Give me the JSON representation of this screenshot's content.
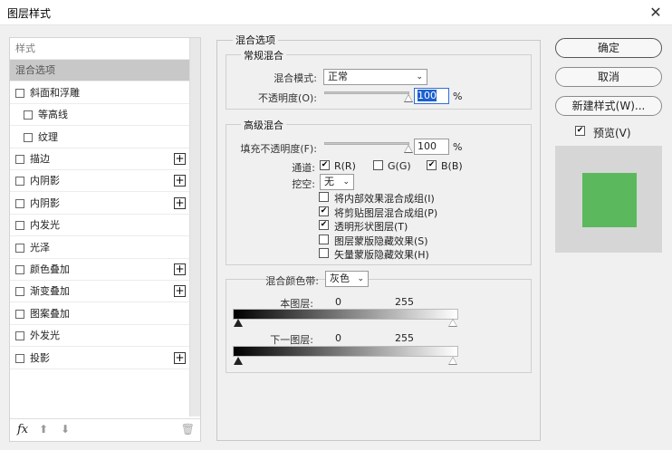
{
  "window": {
    "title": "图层样式",
    "close_glyph": "✕"
  },
  "left_panel": {
    "items": [
      {
        "label": "样式",
        "kind": "section"
      },
      {
        "label": "混合选项",
        "kind": "selected"
      },
      {
        "label": "斜面和浮雕",
        "kind": "check",
        "checked": false,
        "plus": false
      },
      {
        "label": "等高线",
        "kind": "check-indent",
        "checked": false,
        "plus": false
      },
      {
        "label": "纹理",
        "kind": "check-indent",
        "checked": false,
        "plus": false
      },
      {
        "label": "描边",
        "kind": "check",
        "checked": false,
        "plus": true
      },
      {
        "label": "内阴影",
        "kind": "check",
        "checked": false,
        "plus": true
      },
      {
        "label": "内阴影",
        "kind": "check",
        "checked": false,
        "plus": true
      },
      {
        "label": "内发光",
        "kind": "check",
        "checked": false,
        "plus": false
      },
      {
        "label": "光泽",
        "kind": "check",
        "checked": false,
        "plus": false
      },
      {
        "label": "颜色叠加",
        "kind": "check",
        "checked": false,
        "plus": true
      },
      {
        "label": "渐变叠加",
        "kind": "check",
        "checked": false,
        "plus": true
      },
      {
        "label": "图案叠加",
        "kind": "check",
        "checked": false,
        "plus": false
      },
      {
        "label": "外发光",
        "kind": "check",
        "checked": false,
        "plus": false
      },
      {
        "label": "投影",
        "kind": "check",
        "checked": false,
        "plus": true
      }
    ],
    "plus_glyph": "+",
    "footer": {
      "fx": "fx",
      "up": "⬆",
      "down": "⬇",
      "trash": "🗑"
    }
  },
  "blend_options": {
    "legend": "混合选项",
    "general": {
      "legend": "常规混合",
      "mode_label": "混合模式:",
      "mode_value": "正常",
      "opacity_label": "不透明度(O):",
      "opacity_value": "100",
      "opacity_fraction": 1.0,
      "pct": "%"
    },
    "advanced": {
      "legend": "高级混合",
      "fill_label": "填充不透明度(F):",
      "fill_value": "100",
      "fill_fraction": 1.0,
      "pct": "%",
      "channels_label": "通道:",
      "channel_r": "R(R)",
      "channel_g": "G(G)",
      "channel_b": "B(B)",
      "knockout_label": "挖空:",
      "knockout_value": "无",
      "options": [
        {
          "label": "将内部效果混合成组(I)",
          "checked": false
        },
        {
          "label": "将剪贴图层混合成组(P)",
          "checked": true
        },
        {
          "label": "透明形状图层(T)",
          "checked": true
        },
        {
          "label": "图层蒙版隐藏效果(S)",
          "checked": false
        },
        {
          "label": "矢量蒙版隐藏效果(H)",
          "checked": false
        }
      ]
    },
    "blend_if": {
      "label": "混合颜色带:",
      "value": "灰色",
      "this_layer_label": "本图层:",
      "this_layer_min": "0",
      "this_layer_max": "255",
      "under_layer_label": "下一图层:",
      "under_layer_min": "0",
      "under_layer_max": "255"
    }
  },
  "buttons": {
    "ok": "确定",
    "cancel": "取消",
    "new_style": "新建样式(W)..."
  },
  "preview": {
    "label": "预览(V)",
    "checked": true,
    "swatch_color": "#5cb85c"
  },
  "check_glyph": "✔",
  "dropdown_glyph": "⌄"
}
